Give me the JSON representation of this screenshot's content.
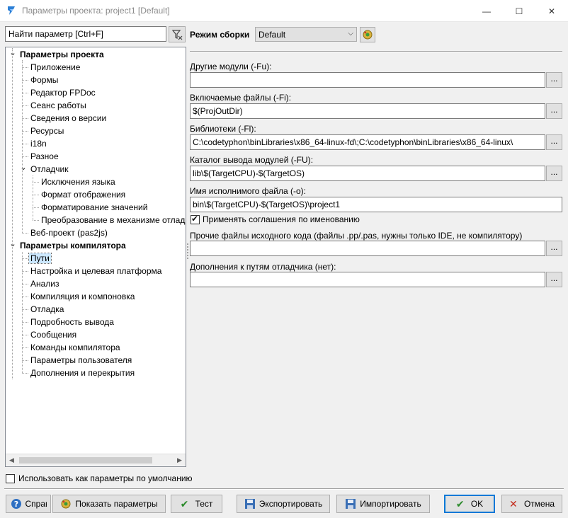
{
  "window": {
    "title": "Параметры проекта: project1 [Default]",
    "minimize_glyph": "—",
    "maximize_glyph": "☐",
    "close_glyph": "✕"
  },
  "filter": {
    "value": "Найти параметр [Ctrl+F]"
  },
  "tree": {
    "items": [
      {
        "label": "Параметры проекта",
        "bold": true,
        "level": 0,
        "expanded": true
      },
      {
        "label": "Приложение",
        "level": 1
      },
      {
        "label": "Формы",
        "level": 1
      },
      {
        "label": "Редактор FPDoc",
        "level": 1
      },
      {
        "label": "Сеанс работы",
        "level": 1
      },
      {
        "label": "Сведения о версии",
        "level": 1
      },
      {
        "label": "Ресурсы",
        "level": 1
      },
      {
        "label": "i18n",
        "level": 1
      },
      {
        "label": "Разное",
        "level": 1
      },
      {
        "label": "Отладчик",
        "level": 1,
        "expanded": true
      },
      {
        "label": "Исключения языка",
        "level": 2
      },
      {
        "label": "Формат отображения",
        "level": 2
      },
      {
        "label": "Форматирование значений",
        "level": 2
      },
      {
        "label": "Преобразование в механизме отладчика",
        "level": 2
      },
      {
        "label": "Веб-проект (pas2js)",
        "level": 1
      },
      {
        "label": "Параметры компилятора",
        "bold": true,
        "level": 0,
        "expanded": true
      },
      {
        "label": "Пути",
        "level": 1,
        "selected": true
      },
      {
        "label": "Настройка и целевая платформа",
        "level": 1
      },
      {
        "label": "Анализ",
        "level": 1
      },
      {
        "label": "Компиляция и компоновка",
        "level": 1
      },
      {
        "label": "Отладка",
        "level": 1
      },
      {
        "label": "Подробность вывода",
        "level": 1
      },
      {
        "label": "Сообщения",
        "level": 1
      },
      {
        "label": "Команды компилятора",
        "level": 1
      },
      {
        "label": "Параметры пользователя",
        "level": 1
      },
      {
        "label": "Дополнения и перекрытия",
        "level": 1
      }
    ]
  },
  "use_default": {
    "label": "Использовать как параметры по умолчанию",
    "checked": false
  },
  "build_mode": {
    "label": "Режим сборки",
    "value": "Default"
  },
  "fields": {
    "other_units": {
      "label": "Другие модули (-Fu):",
      "value": ""
    },
    "include_files": {
      "label": "Включаемые файлы (-Fi):",
      "value": "$(ProjOutDir)"
    },
    "libraries": {
      "label": "Библиотеки (-Fl):",
      "value": "C:\\codetyphon\\binLibraries\\x86_64-linux-fd\\;C:\\codetyphon\\binLibraries\\x86_64-linux\\"
    },
    "unit_output": {
      "label": "Каталог вывода модулей (-FU):",
      "value": "lib\\$(TargetCPU)-$(TargetOS)"
    },
    "target_file": {
      "label": "Имя исполнимого файла (-o):",
      "value": "bin\\$(TargetCPU)-$(TargetOS)\\project1"
    },
    "other_sources": {
      "label": "Прочие файлы исходного кода (файлы .pp/.pas, нужны только IDE, не компилятору)",
      "value": ""
    },
    "debug_paths": {
      "label": "Дополнения к путям отладчика (нет):",
      "value": ""
    }
  },
  "naming": {
    "label": "Применять соглашения по именованию",
    "checked": true
  },
  "browse_label": "...",
  "buttons": {
    "help": "Справка",
    "show_options": "Показать параметры",
    "test": "Тест",
    "export": "Экспортировать",
    "import": "Импортировать",
    "ok": "OK",
    "cancel": "Отмена"
  }
}
